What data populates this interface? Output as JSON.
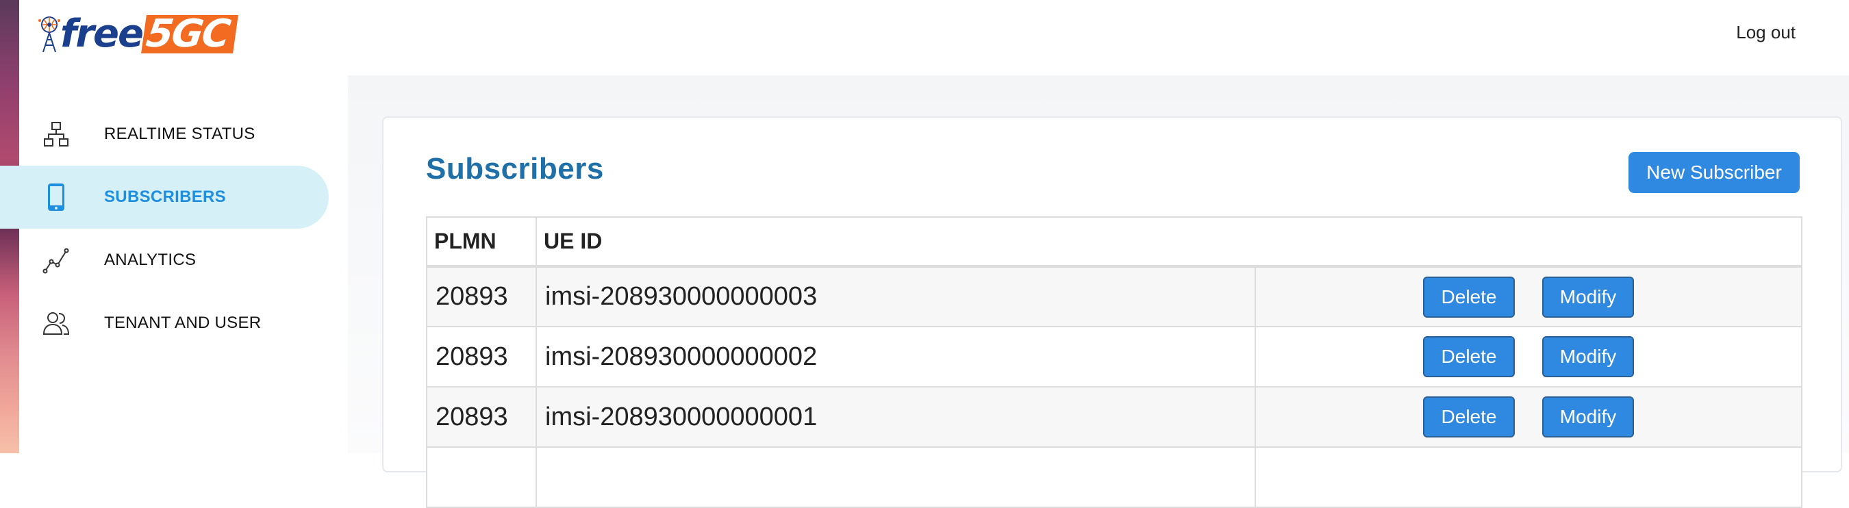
{
  "brand": {
    "name_part1": "free",
    "name_part2": "5GC"
  },
  "header": {
    "logout_label": "Log out"
  },
  "sidebar": {
    "items": [
      {
        "label": "REALTIME STATUS",
        "icon": "network-icon",
        "active": false
      },
      {
        "label": "SUBSCRIBERS",
        "icon": "phone-icon",
        "active": true
      },
      {
        "label": "ANALYTICS",
        "icon": "analytics-icon",
        "active": false
      },
      {
        "label": "TENANT AND USER",
        "icon": "users-icon",
        "active": false
      }
    ]
  },
  "main": {
    "title": "Subscribers",
    "new_button_label": "New Subscriber",
    "table": {
      "columns": [
        "PLMN",
        "UE ID"
      ],
      "rows": [
        {
          "plmn": "20893",
          "ue_id": "imsi-208930000000003"
        },
        {
          "plmn": "20893",
          "ue_id": "imsi-208930000000002"
        },
        {
          "plmn": "20893",
          "ue_id": "imsi-208930000000001"
        }
      ],
      "delete_label": "Delete",
      "modify_label": "Modify"
    }
  },
  "colors": {
    "accent": "#2f89e0",
    "title": "#1f6fa8",
    "active_nav_bg": "#d6f0f8",
    "active_nav_text": "#1e8fe0",
    "logo_blue": "#1a3f8c",
    "logo_orange": "#f26b21"
  }
}
